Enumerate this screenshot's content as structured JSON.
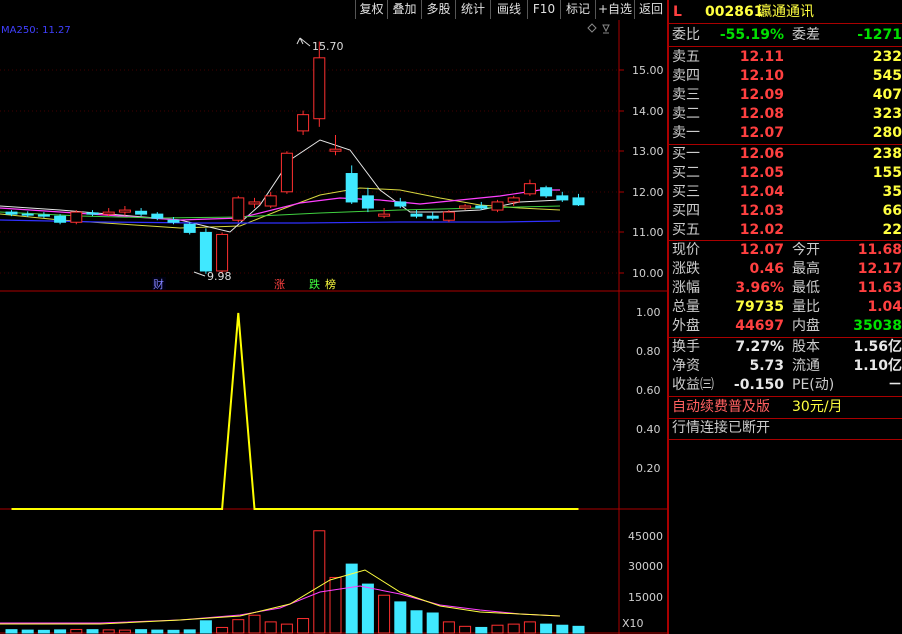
{
  "toolbar": [
    "复权",
    "叠加",
    "多股",
    "统计",
    "画线",
    "F10",
    "标记",
    "+自选",
    "返回"
  ],
  "ma_label": "MA250: 11.27",
  "price_axis": [
    "15.00",
    "14.00",
    "13.00",
    "12.00",
    "11.00",
    "10.00"
  ],
  "high_marker": "15.70",
  "low_marker": "9.98",
  "events": {
    "cai": "财",
    "zhang": "涨",
    "die": "跌",
    "bang": "榜"
  },
  "ind_axis": [
    "1.00",
    "0.80",
    "0.60",
    "0.40",
    "0.20"
  ],
  "vol_axis": [
    "45000",
    "30000",
    "15000"
  ],
  "vol_unit": "X10",
  "chart_data": {
    "type": "candlestick",
    "candles": [
      [
        11.5,
        11.55,
        11.4,
        11.45
      ],
      [
        11.45,
        11.52,
        11.38,
        11.43
      ],
      [
        11.43,
        11.5,
        11.35,
        11.4
      ],
      [
        11.4,
        11.45,
        11.2,
        11.25
      ],
      [
        11.25,
        11.55,
        11.2,
        11.5
      ],
      [
        11.48,
        11.55,
        11.4,
        11.45
      ],
      [
        11.45,
        11.6,
        11.4,
        11.5
      ],
      [
        11.5,
        11.65,
        11.42,
        11.55
      ],
      [
        11.52,
        11.6,
        11.4,
        11.45
      ],
      [
        11.45,
        11.5,
        11.3,
        11.35
      ],
      [
        11.3,
        11.38,
        11.2,
        11.25
      ],
      [
        11.2,
        11.25,
        10.95,
        11.0
      ],
      [
        11.0,
        11.1,
        9.98,
        10.05
      ],
      [
        10.05,
        11.0,
        9.98,
        10.95
      ],
      [
        11.3,
        11.9,
        11.25,
        11.85
      ],
      [
        11.7,
        11.85,
        11.6,
        11.75
      ],
      [
        11.65,
        12.0,
        11.6,
        11.9
      ],
      [
        12.0,
        13.0,
        11.95,
        12.95
      ],
      [
        13.5,
        14.0,
        13.4,
        13.9
      ],
      [
        13.8,
        15.7,
        13.6,
        15.3
      ],
      [
        13.0,
        13.4,
        12.9,
        13.05
      ],
      [
        12.45,
        12.65,
        11.7,
        11.75
      ],
      [
        11.9,
        12.1,
        11.5,
        11.6
      ],
      [
        11.4,
        11.6,
        11.35,
        11.45
      ],
      [
        11.75,
        11.85,
        11.6,
        11.65
      ],
      [
        11.45,
        11.55,
        11.35,
        11.4
      ],
      [
        11.4,
        11.5,
        11.3,
        11.35
      ],
      [
        11.3,
        11.55,
        11.25,
        11.5
      ],
      [
        11.6,
        11.7,
        11.55,
        11.65
      ],
      [
        11.65,
        11.75,
        11.55,
        11.6
      ],
      [
        11.55,
        11.8,
        11.5,
        11.75
      ],
      [
        11.75,
        11.9,
        11.65,
        11.85
      ],
      [
        11.95,
        12.3,
        11.9,
        12.2
      ],
      [
        12.1,
        12.15,
        11.85,
        11.9
      ],
      [
        11.9,
        12.0,
        11.75,
        11.8
      ],
      [
        11.85,
        11.95,
        11.65,
        11.68
      ]
    ],
    "indicator": [
      0,
      0,
      0,
      0,
      0,
      0,
      0,
      0,
      0,
      0,
      0,
      0,
      0,
      0,
      1,
      0,
      0,
      0,
      0,
      0,
      0,
      0,
      0,
      0,
      0,
      0,
      0,
      0,
      0,
      0,
      0,
      0,
      0,
      0,
      0,
      0
    ],
    "volume": [
      1500,
      1300,
      1200,
      1400,
      1600,
      1500,
      1400,
      1300,
      1500,
      1300,
      1200,
      1400,
      5500,
      2500,
      6000,
      8000,
      5000,
      4000,
      6500,
      46000,
      25000,
      31000,
      22000,
      17000,
      14000,
      10000,
      9000,
      5000,
      3000,
      2500,
      3500,
      4000,
      5000,
      4000,
      3500,
      3000
    ]
  },
  "stock": {
    "flag": "L",
    "code": "002861",
    "name": "瀛通通讯"
  },
  "weibi": {
    "label": "委比",
    "value": "-55.19%",
    "label2": "委差",
    "value2": "-1271"
  },
  "sell": [
    {
      "label": "卖五",
      "price": "12.11",
      "vol": "232"
    },
    {
      "label": "卖四",
      "price": "12.10",
      "vol": "545"
    },
    {
      "label": "卖三",
      "price": "12.09",
      "vol": "407"
    },
    {
      "label": "卖二",
      "price": "12.08",
      "vol": "323"
    },
    {
      "label": "卖一",
      "price": "12.07",
      "vol": "280"
    }
  ],
  "buy": [
    {
      "label": "买一",
      "price": "12.06",
      "vol": "238"
    },
    {
      "label": "买二",
      "price": "12.05",
      "vol": "155"
    },
    {
      "label": "买三",
      "price": "12.04",
      "vol": "35"
    },
    {
      "label": "买四",
      "price": "12.03",
      "vol": "66"
    },
    {
      "label": "买五",
      "price": "12.02",
      "vol": "22"
    }
  ],
  "quote": [
    {
      "l1": "现价",
      "v1": "12.07",
      "l2": "今开",
      "v2": "11.68"
    },
    {
      "l1": "涨跌",
      "v1": "0.46",
      "l2": "最高",
      "v2": "12.17"
    },
    {
      "l1": "涨幅",
      "v1": "3.96%",
      "l2": "最低",
      "v2": "11.63"
    },
    {
      "l1": "总量",
      "v1": "79735",
      "l2": "量比",
      "v2": "1.04"
    },
    {
      "l1": "外盘",
      "v1": "44697",
      "l2": "内盘",
      "v2": "35038"
    }
  ],
  "fin": [
    {
      "l1": "换手",
      "v1": "7.27%",
      "l2": "股本",
      "v2": "1.56亿"
    },
    {
      "l1": "净资",
      "v1": "5.73",
      "l2": "流通",
      "v2": "1.10亿"
    },
    {
      "l1": "收益㈢",
      "v1": "-0.150",
      "l2": "PE(动)",
      "v2": "－"
    }
  ],
  "promo": {
    "text": "自动续费普及版",
    "price": "30元/月"
  },
  "status": "行情连接已断开"
}
